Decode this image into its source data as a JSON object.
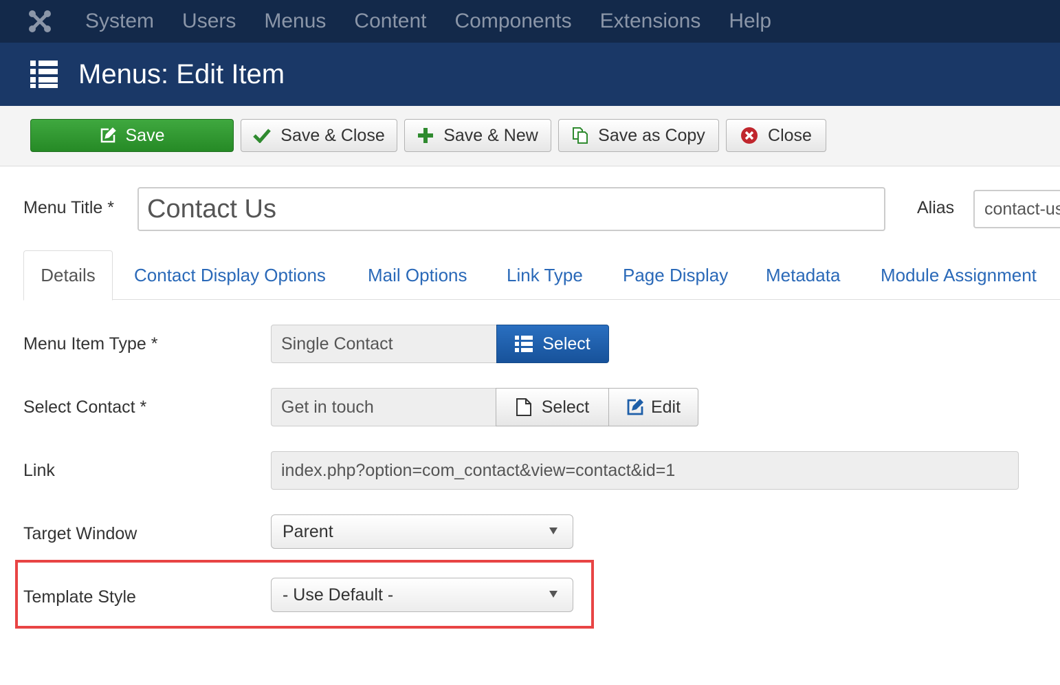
{
  "topnav": {
    "logo_icon": "joomla-logo-icon",
    "items": [
      "System",
      "Users",
      "Menus",
      "Content",
      "Components",
      "Extensions",
      "Help"
    ]
  },
  "header": {
    "icon": "list-icon",
    "title": "Menus: Edit Item"
  },
  "toolbar": {
    "save": "Save",
    "save_close": "Save & Close",
    "save_new": "Save & New",
    "save_copy": "Save as Copy",
    "close": "Close"
  },
  "title_row": {
    "menu_title_label": "Menu Title *",
    "menu_title_value": "Contact Us",
    "alias_label": "Alias",
    "alias_value": "contact-us"
  },
  "tabs": [
    "Details",
    "Contact Display Options",
    "Mail Options",
    "Link Type",
    "Page Display",
    "Metadata",
    "Module Assignment"
  ],
  "form": {
    "menu_item_type": {
      "label": "Menu Item Type *",
      "value": "Single Contact",
      "select": "Select"
    },
    "select_contact": {
      "label": "Select Contact *",
      "value": "Get in touch",
      "select": "Select",
      "edit": "Edit"
    },
    "link": {
      "label": "Link",
      "value": "index.php?option=com_contact&view=contact&id=1"
    },
    "target_window": {
      "label": "Target Window",
      "value": "Parent"
    },
    "template_style": {
      "label": "Template Style",
      "value": "- Use Default -"
    }
  },
  "colors": {
    "topnav_bg": "#13294a",
    "header_bg": "#1a3867",
    "save_green": "#2f9a2f",
    "select_blue": "#1d5ea8",
    "tab_link": "#2a69b8",
    "highlight_red": "#e84444"
  }
}
